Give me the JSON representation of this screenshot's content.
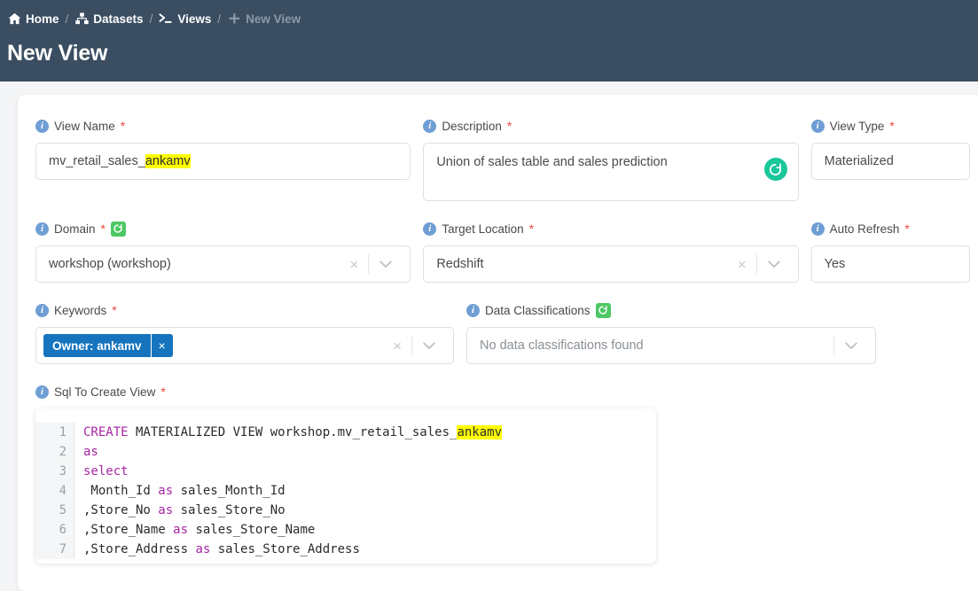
{
  "header": {
    "breadcrumb": [
      {
        "label": "Home",
        "icon": "home-icon",
        "current": false
      },
      {
        "label": "Datasets",
        "icon": "datasets-icon",
        "current": false
      },
      {
        "label": "Views",
        "icon": "terminal-icon",
        "current": false
      },
      {
        "label": "New View",
        "icon": "plus-icon",
        "current": true
      }
    ],
    "separator": "/",
    "title": "New View",
    "bg_color": "#3a4d61"
  },
  "form": {
    "view_name": {
      "label": "View Name",
      "required": true,
      "value_prefix": "mv_retail_sales_",
      "value_highlight": "ankamv"
    },
    "description": {
      "label": "Description",
      "required": true,
      "value": "Union of sales table and sales prediction",
      "refresh_icon": "regenerate-icon",
      "refresh_color": "#18c79a"
    },
    "view_type": {
      "label": "View Type",
      "required": true,
      "value": "Materialized"
    },
    "domain": {
      "label": "Domain",
      "required": true,
      "refresh_badge": "refresh-icon",
      "value": "workshop (workshop)",
      "clear": "×"
    },
    "target_location": {
      "label": "Target Location",
      "required": true,
      "value": "Redshift",
      "clear": "×"
    },
    "auto_refresh": {
      "label": "Auto Refresh",
      "required": true,
      "value": "Yes"
    },
    "keywords": {
      "label": "Keywords",
      "required": true,
      "chips": [
        {
          "label": "Owner: ankamv",
          "remove": "×"
        }
      ],
      "clear": "×"
    },
    "data_classifications": {
      "label": "Data Classifications",
      "required": false,
      "refresh_badge": "refresh-icon",
      "placeholder": "No data classifications found"
    },
    "sql": {
      "label": "Sql To Create View",
      "required": true,
      "lines": [
        {
          "n": "1",
          "parts": [
            {
              "t": "CREATE",
              "k": "kw"
            },
            {
              "t": " MATERIALIZED VIEW workshop.mv_retail_sales_",
              "k": ""
            },
            {
              "t": "ankamv",
              "k": "hl"
            }
          ]
        },
        {
          "n": "2",
          "parts": [
            {
              "t": "as",
              "k": "kw"
            }
          ]
        },
        {
          "n": "3",
          "parts": [
            {
              "t": "select",
              "k": "kw"
            }
          ]
        },
        {
          "n": "4",
          "parts": [
            {
              "t": " Month_Id ",
              "k": ""
            },
            {
              "t": "as",
              "k": "kw"
            },
            {
              "t": " sales_Month_Id",
              "k": ""
            }
          ]
        },
        {
          "n": "5",
          "parts": [
            {
              "t": ",Store_No ",
              "k": ""
            },
            {
              "t": "as",
              "k": "kw"
            },
            {
              "t": " sales_Store_No",
              "k": ""
            }
          ]
        },
        {
          "n": "6",
          "parts": [
            {
              "t": ",Store_Name ",
              "k": ""
            },
            {
              "t": "as",
              "k": "kw"
            },
            {
              "t": " sales_Store_Name",
              "k": ""
            }
          ]
        },
        {
          "n": "7",
          "parts": [
            {
              "t": ",Store_Address ",
              "k": ""
            },
            {
              "t": "as",
              "k": "kw"
            },
            {
              "t": " sales_Store_Address",
              "k": ""
            }
          ]
        }
      ]
    }
  }
}
